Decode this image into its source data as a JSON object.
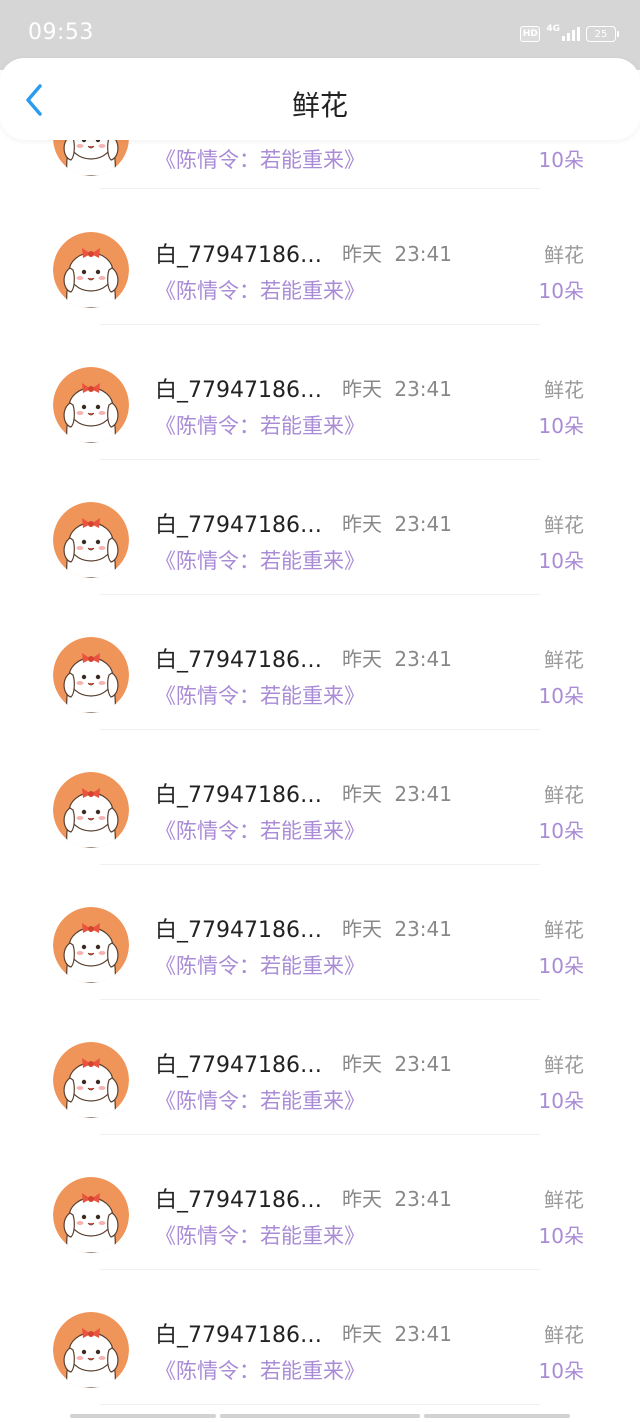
{
  "status_bar": {
    "time": "09:53",
    "hd_badge": "HD",
    "network": "4G",
    "battery": "25"
  },
  "header": {
    "title": "鲜花",
    "back_icon": "chevron-left-icon",
    "accent_color": "#2c9cf0"
  },
  "colors": {
    "purple_text": "#a98bd6",
    "avatar_bg": "#f0955a"
  },
  "list": {
    "partial_item": {
      "book": "《陈情令：若能重来》",
      "count": "10朵"
    },
    "items": [
      {
        "username": "白_77947186…",
        "time": "昨天 23:41",
        "gift": "鲜花",
        "book": "《陈情令：若能重来》",
        "count": "10朵"
      },
      {
        "username": "白_77947186…",
        "time": "昨天 23:41",
        "gift": "鲜花",
        "book": "《陈情令：若能重来》",
        "count": "10朵"
      },
      {
        "username": "白_77947186…",
        "time": "昨天 23:41",
        "gift": "鲜花",
        "book": "《陈情令：若能重来》",
        "count": "10朵"
      },
      {
        "username": "白_77947186…",
        "time": "昨天 23:41",
        "gift": "鲜花",
        "book": "《陈情令：若能重来》",
        "count": "10朵"
      },
      {
        "username": "白_77947186…",
        "time": "昨天 23:41",
        "gift": "鲜花",
        "book": "《陈情令：若能重来》",
        "count": "10朵"
      },
      {
        "username": "白_77947186…",
        "time": "昨天 23:41",
        "gift": "鲜花",
        "book": "《陈情令：若能重来》",
        "count": "10朵"
      },
      {
        "username": "白_77947186…",
        "time": "昨天 23:41",
        "gift": "鲜花",
        "book": "《陈情令：若能重来》",
        "count": "10朵"
      },
      {
        "username": "白_77947186…",
        "time": "昨天 23:41",
        "gift": "鲜花",
        "book": "《陈情令：若能重来》",
        "count": "10朵"
      },
      {
        "username": "白_77947186…",
        "time": "昨天 23:41",
        "gift": "鲜花",
        "book": "《陈情令：若能重来》",
        "count": "10朵"
      }
    ]
  }
}
